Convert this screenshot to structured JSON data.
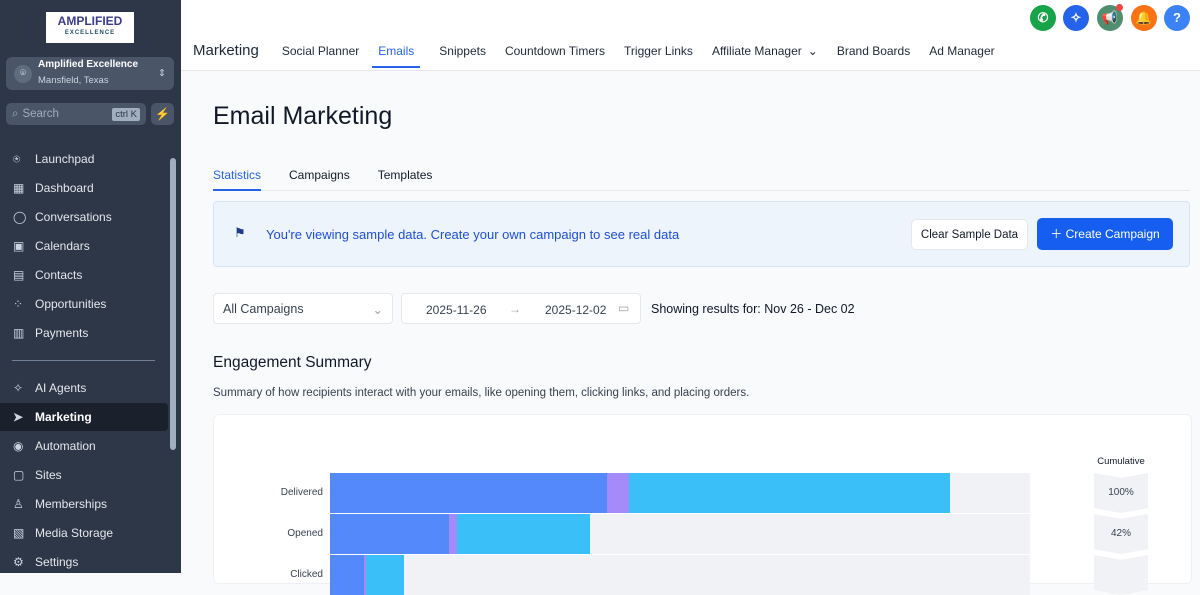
{
  "sidebar": {
    "logo_line1": "AMPLIFIED",
    "logo_line2": "EXCELLENCE",
    "account_name": "Amplified Excellence",
    "account_location": "Mansfield, Texas",
    "search_placeholder": "Search",
    "search_shortcut": "ctrl K",
    "items": [
      {
        "label": "Launchpad",
        "icon": "rocket-icon"
      },
      {
        "label": "Dashboard",
        "icon": "grid-icon"
      },
      {
        "label": "Conversations",
        "icon": "chat-icon"
      },
      {
        "label": "Calendars",
        "icon": "calendar-icon"
      },
      {
        "label": "Contacts",
        "icon": "contacts-icon"
      },
      {
        "label": "Opportunities",
        "icon": "opportunities-icon"
      },
      {
        "label": "Payments",
        "icon": "payments-icon"
      }
    ],
    "items2": [
      {
        "label": "AI Agents",
        "icon": "sparkle-icon"
      },
      {
        "label": "Marketing",
        "icon": "send-icon",
        "active": true
      },
      {
        "label": "Automation",
        "icon": "automation-icon"
      },
      {
        "label": "Sites",
        "icon": "sites-icon"
      },
      {
        "label": "Memberships",
        "icon": "memberships-icon"
      },
      {
        "label": "Media Storage",
        "icon": "media-icon"
      },
      {
        "label": "Settings",
        "icon": "gear-icon"
      }
    ]
  },
  "topnav": {
    "title": "Marketing",
    "tabs": [
      "Social Planner",
      "Emails",
      "Snippets",
      "Countdown Timers",
      "Trigger Links",
      "Affiliate Manager",
      "Brand Boards",
      "Ad Manager"
    ],
    "active": "Emails"
  },
  "page": {
    "title": "Email Marketing",
    "tabs": [
      "Statistics",
      "Campaigns",
      "Templates"
    ],
    "active_tab": "Statistics",
    "banner_text": "You're viewing sample data. Create your own campaign to see real data",
    "clear_label": "Clear Sample Data",
    "create_label": "Create Campaign",
    "campaign_filter": "All Campaigns",
    "date_start": "2025-11-26",
    "date_end": "2025-12-02",
    "results_text": "Showing results for: Nov 26 - Dec 02",
    "section_title": "Engagement Summary",
    "section_desc": "Summary of how recipients interact with your emails, like opening them, clicking links, and placing orders."
  },
  "chart_data": {
    "type": "bar",
    "orientation": "horizontal-stacked",
    "categories": [
      "Delivered",
      "Opened",
      "Clicked"
    ],
    "xlim": [
      0,
      100
    ],
    "series": [
      {
        "name": "segment-1",
        "color": "#5389fb",
        "values": [
          39.6,
          17,
          4.9
        ]
      },
      {
        "name": "segment-2",
        "color": "#a48bf9",
        "values": [
          3.1,
          1.1,
          0.3
        ]
      },
      {
        "name": "segment-3",
        "color": "#3bbff8",
        "values": [
          45.9,
          19,
          5.4
        ]
      }
    ],
    "cumulative_label": "Cumulative",
    "cumulative": [
      "100%",
      "42%",
      ""
    ]
  }
}
